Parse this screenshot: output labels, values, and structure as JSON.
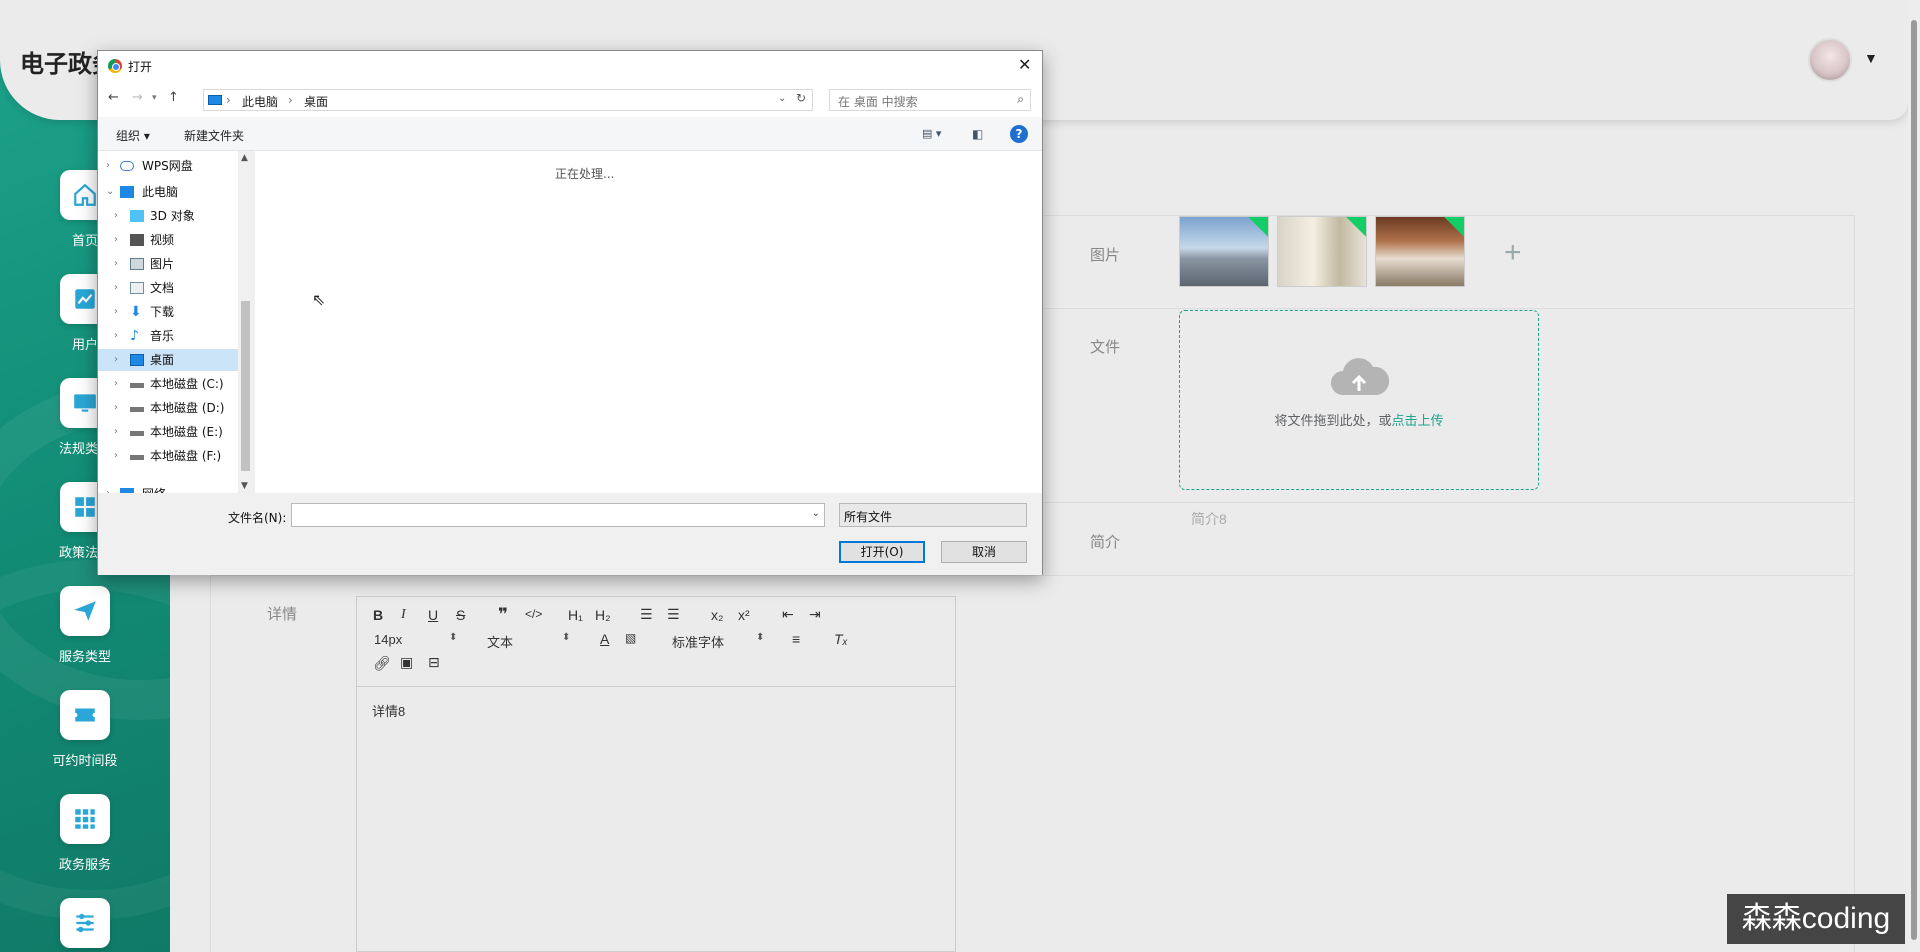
{
  "app": {
    "title": "电子政务服务管理系统"
  },
  "sidebar": {
    "items": [
      {
        "label": "首页",
        "icon": "home-icon"
      },
      {
        "label": "用户",
        "icon": "chart-icon"
      },
      {
        "label": "法规类型",
        "icon": "monitor-icon"
      },
      {
        "label": "政策法规",
        "icon": "grid-icon"
      },
      {
        "label": "服务类型",
        "icon": "send-icon"
      },
      {
        "label": "可约时间段",
        "icon": "ticket-icon"
      },
      {
        "label": "政务服务",
        "icon": "apps-icon"
      },
      {
        "label": "",
        "icon": "sliders-icon"
      }
    ]
  },
  "form": {
    "image_label": "图片",
    "file_label": "文件",
    "intro_label": "简介",
    "detail_label": "详情",
    "upload_text": "将文件拖到此处，或",
    "upload_link": "点击上传",
    "intro_placeholder": "简介8",
    "detail_content": "详情8"
  },
  "editor": {
    "font_size": "14px",
    "block_type": "文本",
    "font_family": "标准字体",
    "tools": [
      "bold-icon",
      "italic-icon",
      "underline-icon",
      "strikethrough-icon",
      "quote-icon",
      "code-icon",
      "h1-icon",
      "h2-icon",
      "ordered-list-icon",
      "bullet-list-icon",
      "subscript-icon",
      "superscript-icon",
      "outdent-icon",
      "indent-icon",
      "link-icon",
      "image-icon",
      "video-icon"
    ]
  },
  "dialog": {
    "title": "打开",
    "breadcrumb": [
      "此电脑",
      "桌面"
    ],
    "search_placeholder": "在 桌面 中搜索",
    "organize": "组织 ▾",
    "new_folder": "新建文件夹",
    "processing": "正在处理...",
    "tree": [
      {
        "label": "WPS网盘",
        "selected": false
      },
      {
        "label": "此电脑",
        "selected": false
      },
      {
        "label": "3D 对象",
        "selected": false
      },
      {
        "label": "视频",
        "selected": false
      },
      {
        "label": "图片",
        "selected": false
      },
      {
        "label": "文档",
        "selected": false
      },
      {
        "label": "下载",
        "selected": false
      },
      {
        "label": "音乐",
        "selected": false
      },
      {
        "label": "桌面",
        "selected": true
      },
      {
        "label": "本地磁盘 (C:)",
        "selected": false
      },
      {
        "label": "本地磁盘 (D:)",
        "selected": false
      },
      {
        "label": "本地磁盘 (E:)",
        "selected": false
      },
      {
        "label": "本地磁盘 (F:)",
        "selected": false
      },
      {
        "label": "网络",
        "selected": false
      }
    ],
    "filename_label": "文件名(N):",
    "filename_value": "",
    "filetype": "所有文件",
    "open_button": "打开(O)",
    "cancel_button": "取消"
  },
  "watermark": "森森coding",
  "colors": {
    "accent": "#1ea38b",
    "dialog_focus": "#0078d7",
    "corner_badge": "#13ce66"
  }
}
